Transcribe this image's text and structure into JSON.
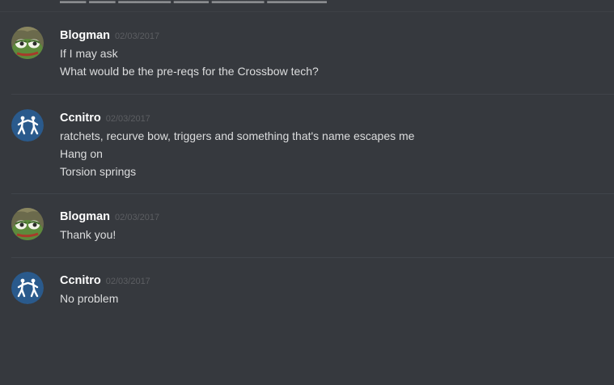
{
  "cutoff_text": "▂▂▂ ▂▂▂ ▂▂▂▂▂▂ ▂▂▂▂ ▂▂▂▂▂▂ ▂▂▂▂▂▂▂",
  "messages": [
    {
      "author": "Blogman",
      "timestamp": "02/03/2017",
      "avatar_icon": "frog-avatar-icon",
      "lines": [
        "If I may ask",
        "What would be the pre-reqs for the Crossbow tech?"
      ]
    },
    {
      "author": "Ccnitro",
      "timestamp": "02/03/2017",
      "avatar_icon": "fencers-avatar-icon",
      "lines": [
        "ratchets, recurve bow, triggers and something that's name escapes me",
        "Hang on",
        "Torsion springs"
      ]
    },
    {
      "author": "Blogman",
      "timestamp": "02/03/2017",
      "avatar_icon": "frog-avatar-icon",
      "lines": [
        "Thank you!"
      ]
    },
    {
      "author": "Ccnitro",
      "timestamp": "02/03/2017",
      "avatar_icon": "fencers-avatar-icon",
      "lines": [
        "No problem"
      ]
    }
  ],
  "colors": {
    "background": "#36393e",
    "username": "#ffffff",
    "timestamp": "#5c5e62",
    "message_text": "#dcddde",
    "divider": "#40444a",
    "fencer_avatar_bg": "#2a5a8c"
  }
}
